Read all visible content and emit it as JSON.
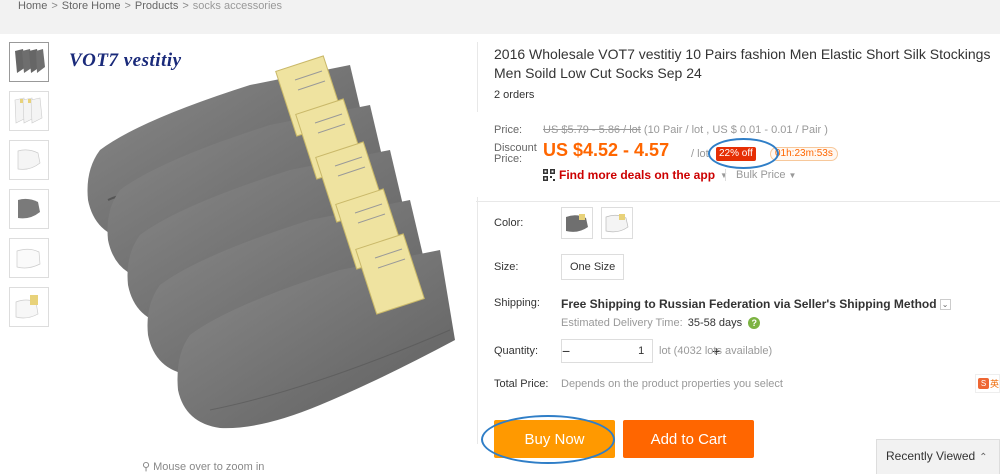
{
  "breadcrumb": {
    "home": "Home",
    "store_home": "Store Home",
    "products": "Products",
    "current": "socks accessories",
    "separator": ">"
  },
  "gallery": {
    "brand_text": "VOT7 vestitiy",
    "zoom_hint": "Mouse over to zoom in",
    "thumbnails": [
      "grey-five-pairs",
      "white-five-pairs",
      "white-single",
      "grey-single",
      "white-single-2",
      "white-pair-tagged"
    ]
  },
  "product": {
    "title": "2016 Wholesale VOT7 vestitiy 10 Pairs fashion Men Elastic Short Silk Stockings Men Soild Low Cut Socks Sep 24",
    "orders": "2 orders"
  },
  "price": {
    "label": "Price:",
    "original": "US $5.79 - 5.86 / lot",
    "original_note": "(10 Pair / lot , US $ 0.01 - 0.01 / Pair )",
    "discount_label": "Discount Price:",
    "sale": "US $4.52 - 4.57",
    "per_lot": "/ lot",
    "off_badge": "22% off",
    "timer": "01h:23m:53s",
    "app_deal": "Find more deals on the app",
    "bulk": "Bulk Price"
  },
  "options": {
    "color_label": "Color:",
    "colors": [
      "grey",
      "white"
    ],
    "size_label": "Size:",
    "size_value": "One Size"
  },
  "shipping": {
    "label": "Shipping:",
    "main": "Free Shipping to Russian Federation via Seller's Shipping Method",
    "delivery_label": "Estimated Delivery Time:",
    "delivery_days": "35-58 days"
  },
  "quantity": {
    "label": "Quantity:",
    "value": "1",
    "minus": "−",
    "plus": "+",
    "available": "lot (4032 lots available)"
  },
  "total": {
    "label": "Total Price:",
    "note": "Depends on the product properties you select"
  },
  "actions": {
    "buy_now": "Buy Now",
    "add_to_cart": "Add to Cart"
  },
  "side": {
    "recently_viewed": "Recently Viewed",
    "icon_text": "英"
  },
  "colors": {
    "accent_orange": "#ff6600",
    "buy_orange": "#ff9900",
    "annotation_blue": "#2f7ec7",
    "badge_red": "#e62e04"
  }
}
